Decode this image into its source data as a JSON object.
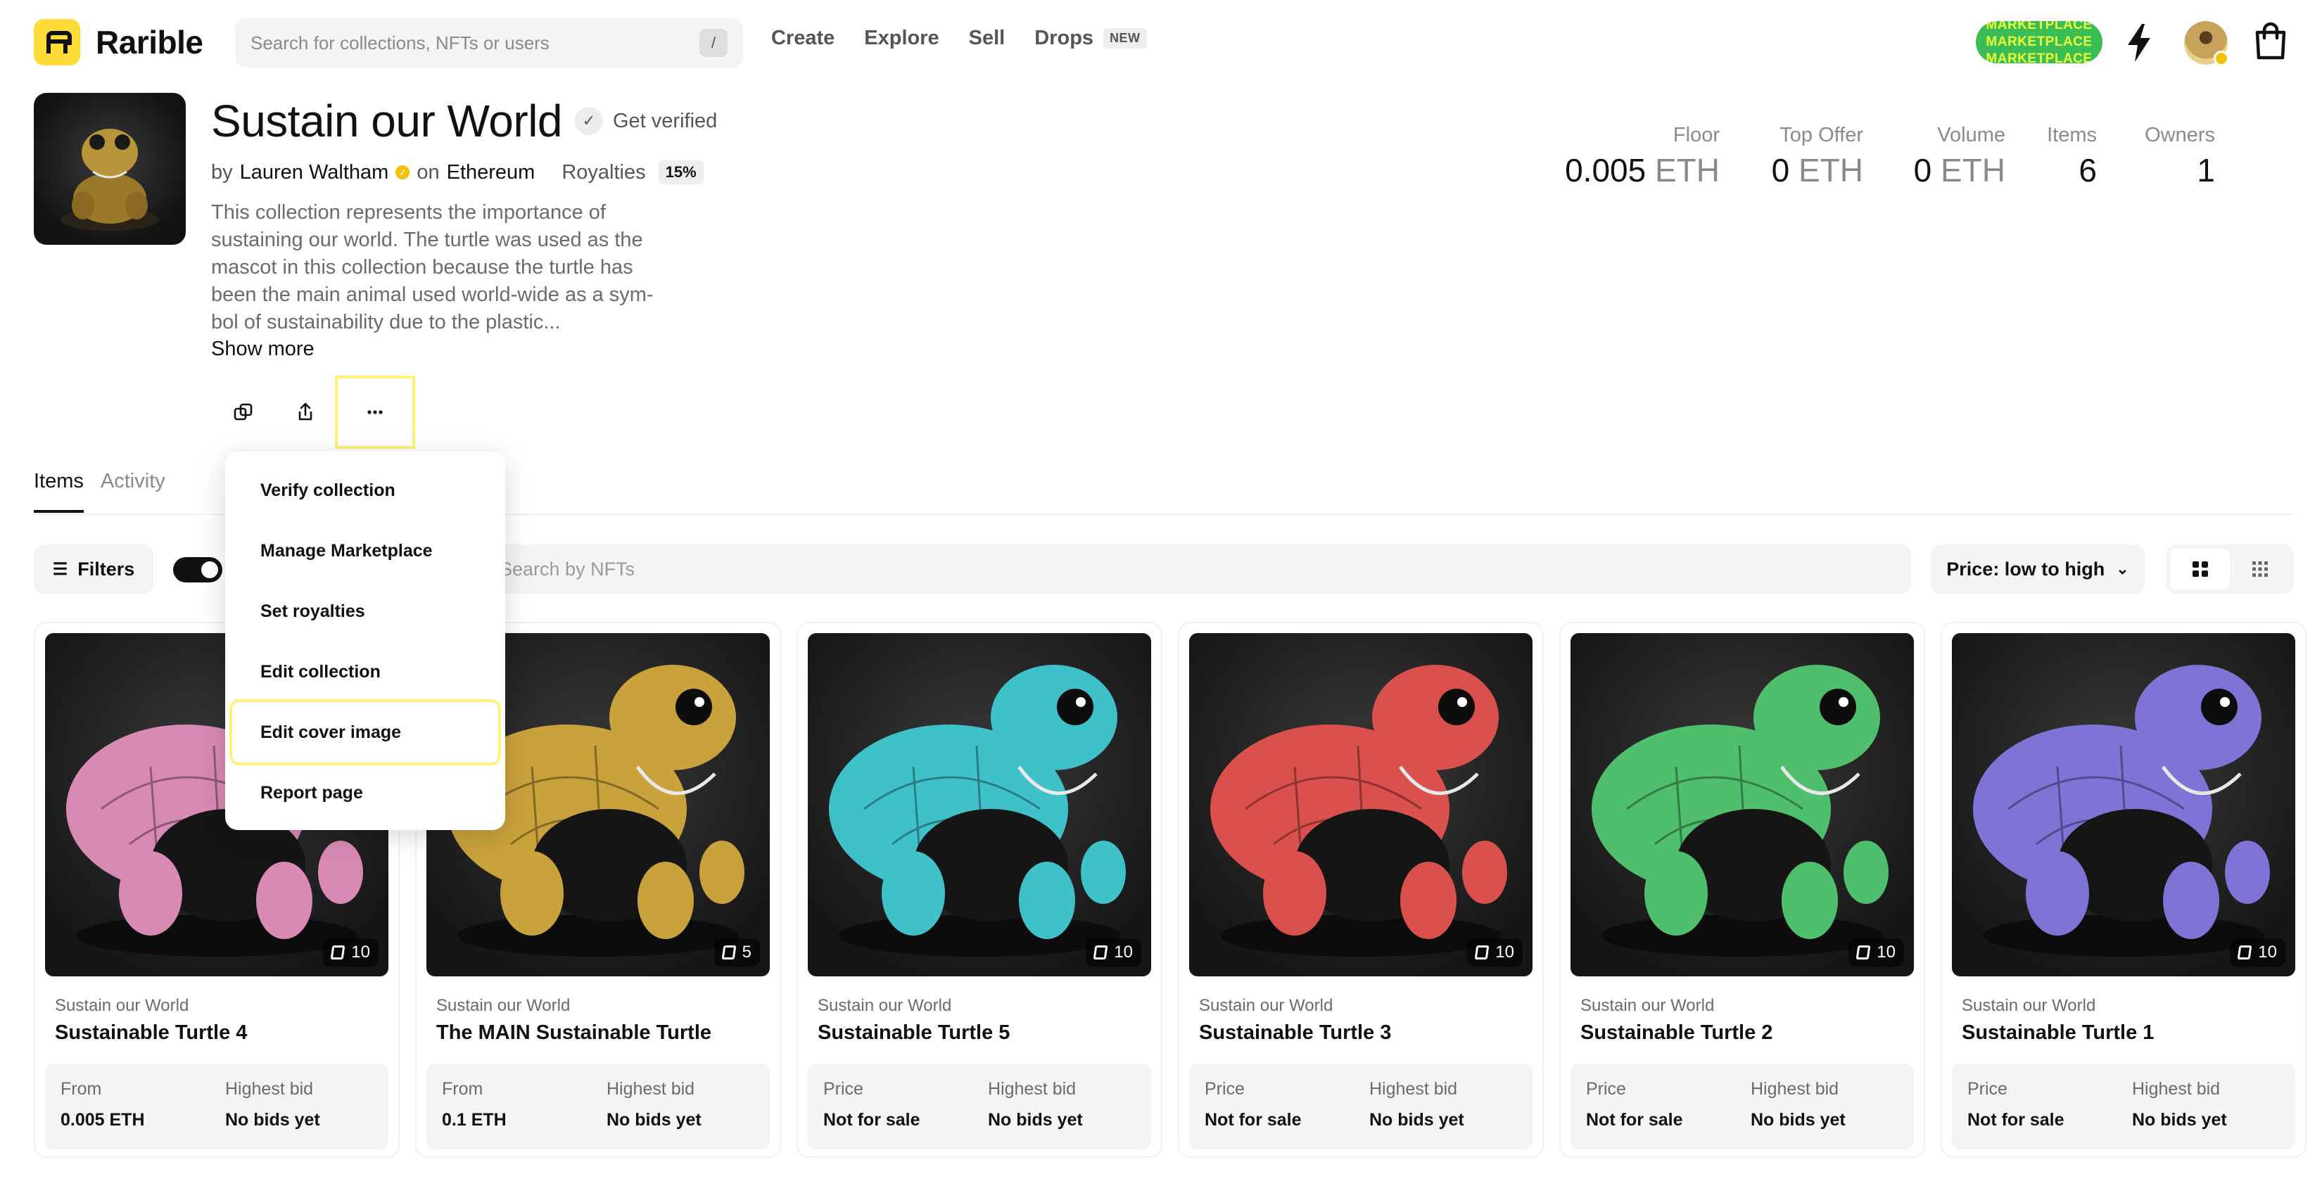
{
  "app": {
    "name": "Rarible"
  },
  "search": {
    "placeholder": "Search for collections, NFTs or users",
    "shortcut": "/"
  },
  "nav": {
    "create": "Create",
    "explore": "Explore",
    "sell": "Sell",
    "drops": "Drops",
    "drops_badge": "NEW"
  },
  "header_right": {
    "marketplace_badge": [
      "MARKETPLACE",
      "MARKETPLACE",
      "MARKETPLACE"
    ],
    "icons": [
      "lightning-icon",
      "avatar",
      "cart-icon"
    ]
  },
  "collection": {
    "title": "Sustain our World",
    "get_verified": "Get verified",
    "by": "by",
    "creator": "Lauren Waltham",
    "on": "on",
    "chain": "Ethereum",
    "royalties_label": "Royalties",
    "royalties_value": "15%",
    "description": "This collection represents the importance of sustaining our world. The turtle was used as the mascot in this collection because the turtle has been the main animal used world-wide as a sym- bol of sustainability due to the plastic...",
    "show_more": "Show more"
  },
  "stats": {
    "floor": {
      "label": "Floor",
      "value": "0.005",
      "unit": "ETH"
    },
    "top_offer": {
      "label": "Top Offer",
      "value": "0",
      "unit": "ETH"
    },
    "volume": {
      "label": "Volume",
      "value": "0",
      "unit": "ETH"
    },
    "items": {
      "label": "Items",
      "value": "6"
    },
    "owners": {
      "label": "Owners",
      "value": "1"
    }
  },
  "tabs": {
    "items": "Items",
    "activity": "Activity"
  },
  "toolbar": {
    "filters": "Filters",
    "search_placeholder": "Search by NFTs",
    "sort": "Price: low to high"
  },
  "menu": {
    "items": [
      "Verify collection",
      "Manage Marketplace",
      "Set royalties",
      "Edit collection",
      "Edit cover image",
      "Report page"
    ]
  },
  "cards": [
    {
      "collection": "Sustain our World",
      "name": "Sustainable Turtle 4",
      "count": "10",
      "price_label": "From",
      "price": "0.005 ETH",
      "bid_label": "Highest bid",
      "bid": "No bids yet",
      "color": "#d98ab4"
    },
    {
      "collection": "Sustain our World",
      "name": "The MAIN Sustainable Turtle",
      "count": "5",
      "price_label": "From",
      "price": "0.1 ETH",
      "bid_label": "Highest bid",
      "bid": "No bids yet",
      "color": "#c9a23c"
    },
    {
      "collection": "Sustain our World",
      "name": "Sustainable Turtle 5",
      "count": "10",
      "price_label": "Price",
      "price": "Not for sale",
      "bid_label": "Highest bid",
      "bid": "No bids yet",
      "color": "#3fc1c9"
    },
    {
      "collection": "Sustain our World",
      "name": "Sustainable Turtle 3",
      "count": "10",
      "price_label": "Price",
      "price": "Not for sale",
      "bid_label": "Highest bid",
      "bid": "No bids yet",
      "color": "#d9504c"
    },
    {
      "collection": "Sustain our World",
      "name": "Sustainable Turtle 2",
      "count": "10",
      "price_label": "Price",
      "price": "Not for sale",
      "bid_label": "Highest bid",
      "bid": "No bids yet",
      "color": "#4fbf6e"
    },
    {
      "collection": "Sustain our World",
      "name": "Sustainable Turtle 1",
      "count": "10",
      "price_label": "Price",
      "price": "Not for sale",
      "bid_label": "Highest bid",
      "bid": "No bids yet",
      "color": "#7d74d6"
    }
  ],
  "colors": {
    "brand_yellow": "#fddb39",
    "marketplace_green": "#3bbd55",
    "highlight_yellow": "#fff17a"
  }
}
